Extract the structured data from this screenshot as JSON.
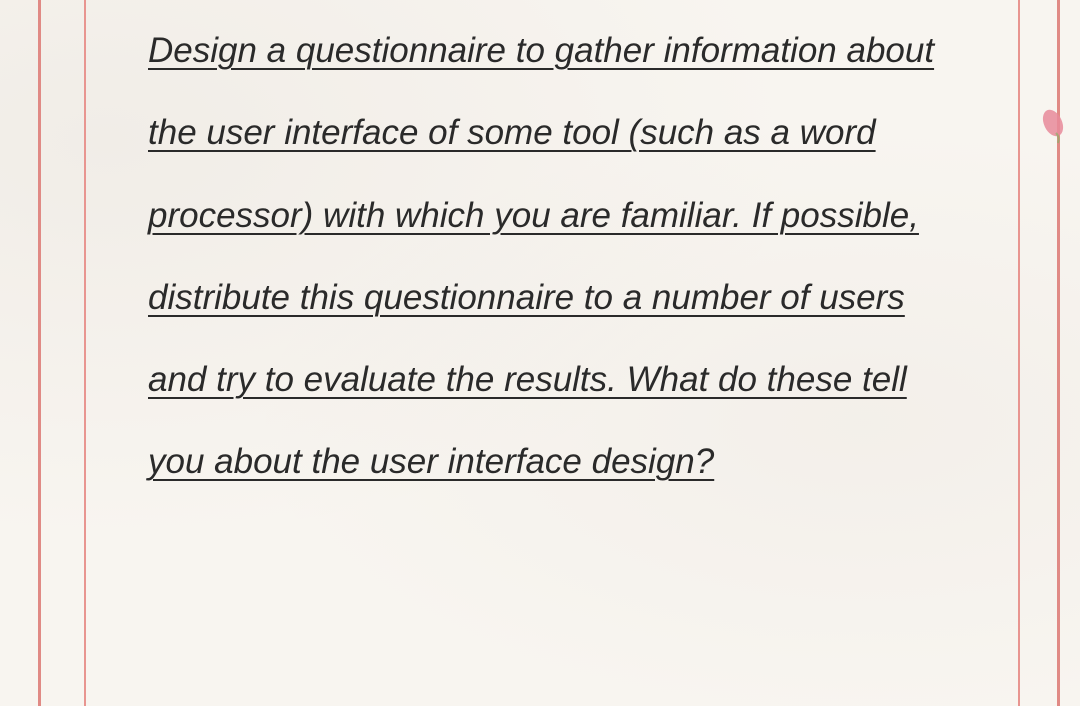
{
  "document": {
    "body_text": "Design a questionnaire to gather information about the user interface of some tool (such as a word processor) with which you are familiar. If possible, distribute this questionnaire to a number of users and try to evaluate the results. What do these tell you about the user interface design?"
  },
  "colors": {
    "background": "#f8f5f0",
    "border": "#e08a85",
    "text": "#2a2a2a",
    "flower_petal": "#e88a9a",
    "flower_leaf": "#8ab068"
  },
  "decoration": {
    "flower_icon": "flower-petal"
  }
}
